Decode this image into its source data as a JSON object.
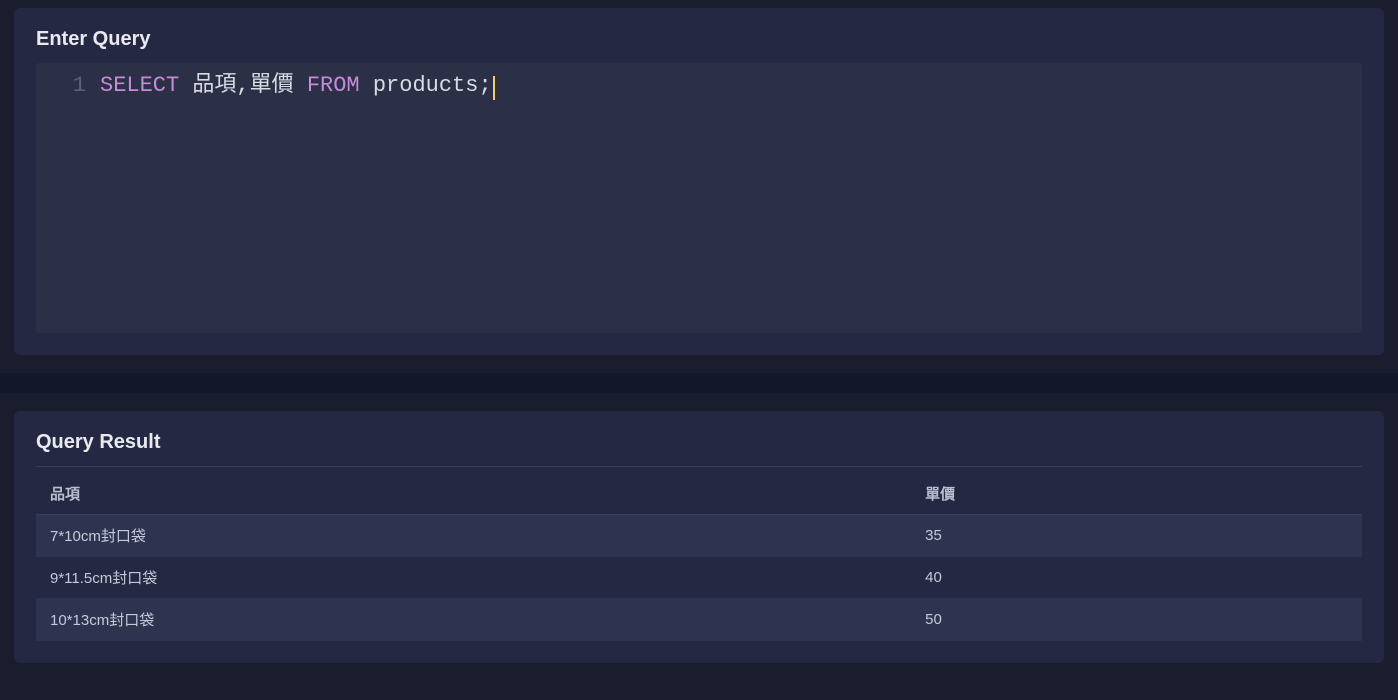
{
  "query_panel": {
    "title": "Enter Query",
    "line_number": "1",
    "tokens": {
      "select": "SELECT",
      "cols": " 品項,單價 ",
      "from": "FROM",
      "table": " products",
      "semi": ";"
    }
  },
  "result_panel": {
    "title": "Query Result",
    "columns": [
      "品項",
      "單價"
    ],
    "rows": [
      {
        "item": "7*10cm封口袋",
        "price": "35"
      },
      {
        "item": "9*11.5cm封口袋",
        "price": "40"
      },
      {
        "item": "10*13cm封口袋",
        "price": "50"
      }
    ]
  }
}
